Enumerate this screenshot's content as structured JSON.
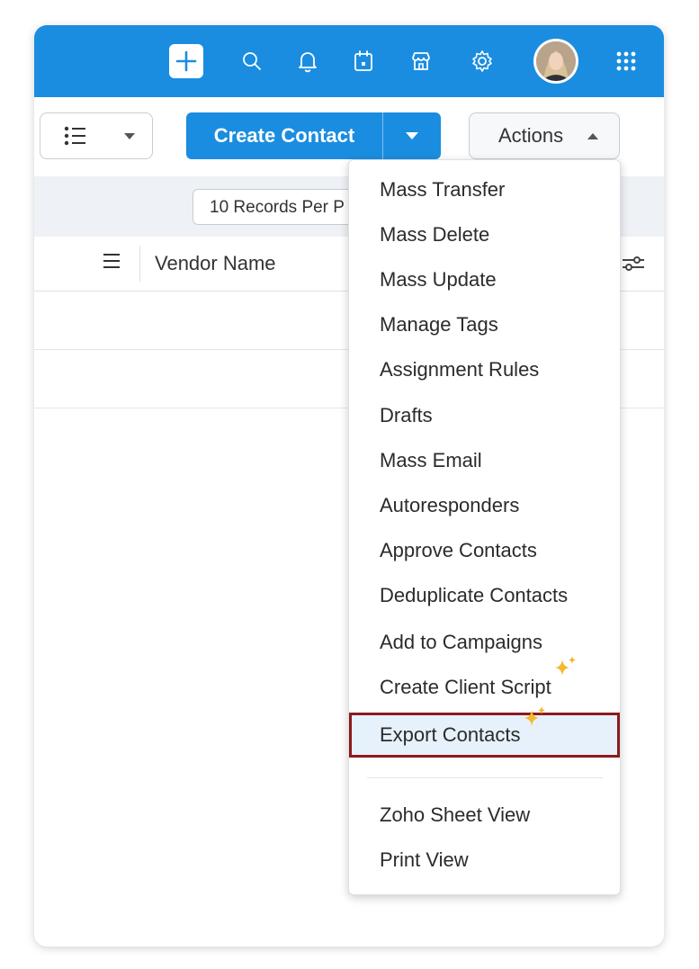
{
  "topbar": {
    "icons": [
      "plus-icon",
      "search-icon",
      "bell-icon",
      "calendar-icon",
      "store-icon",
      "gear-icon",
      "avatar",
      "apps-grid-icon"
    ],
    "color": "#1a8de0"
  },
  "toolbar": {
    "create_label": "Create Contact",
    "actions_label": "Actions"
  },
  "records": {
    "per_page_label": "10 Records Per P"
  },
  "table": {
    "column_header": "Vendor Name"
  },
  "actions_menu": {
    "items": [
      "Mass Transfer",
      "Mass Delete",
      "Mass Update",
      "Manage Tags",
      "Assignment Rules",
      "Drafts",
      "Mass Email",
      "Autoresponders",
      "Approve Contacts",
      "Deduplicate Contacts",
      "Add to Campaigns",
      "Create Client Script",
      "Export Contacts",
      "Zoho Sheet View",
      "Print View"
    ],
    "highlighted": "Export Contacts",
    "highlight_color": "#8b1a1a"
  }
}
